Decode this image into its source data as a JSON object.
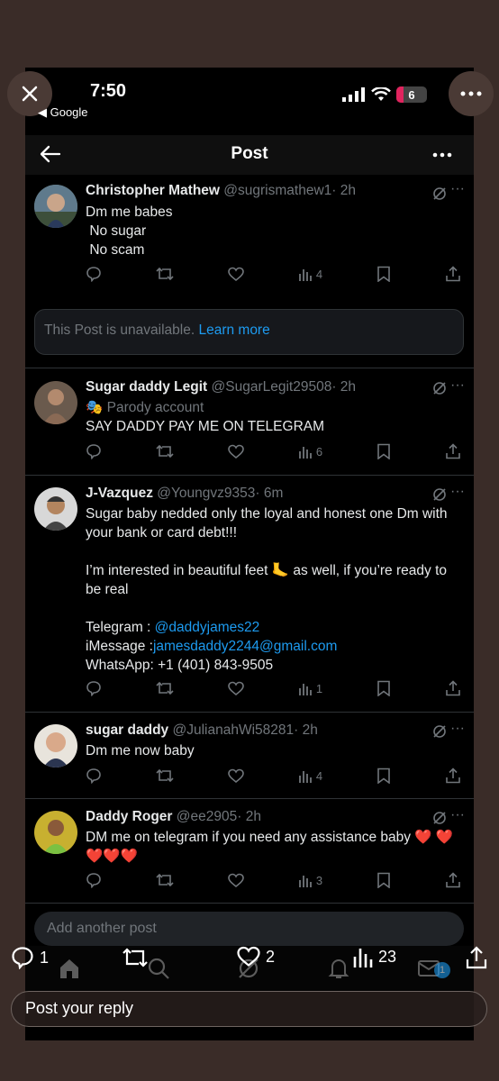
{
  "status": {
    "time": "7:50",
    "back_app": "◀ Google",
    "battery": "6"
  },
  "header": {
    "title": "Post"
  },
  "unavailable": {
    "text": "This Post is unavailable.",
    "link": "Learn more"
  },
  "posts": [
    {
      "name": "Christopher Mathew",
      "handle": "@sugrismathew1",
      "time": "· 2h",
      "lines": [
        "Dm me babes",
        " No sugar",
        " No scam"
      ],
      "views": "4"
    },
    {
      "name": "Sugar daddy Legit",
      "handle": "@SugarLegit29508",
      "time": "· 2h",
      "parody": "Parody account",
      "lines": [
        "SAY DADDY PAY ME ON TELEGRAM"
      ],
      "views": "6"
    },
    {
      "name": "J-Vazquez",
      "handle": "@Youngvz9353",
      "time": "· 6m",
      "line1": "Sugar baby nedded only the loyal and honest one Dm with your bank or card debt!!!",
      "line2a": "I’m interested in beautiful feet ",
      "line2b": "🦶",
      "line2c": " as well, if you’re ready to be real",
      "telegram_label": "Telegram : ",
      "telegram": "@daddyjames22",
      "imessage_label": "iMessage :",
      "imessage": "jamesdaddy2244@gmail.com",
      "whatsapp": "WhatsApp: +1 (401) 843-9505",
      "views": "1"
    },
    {
      "name": "sugar daddy",
      "handle": "@JulianahWi58281",
      "time": "· 2h",
      "lines": [
        "Dm me now baby"
      ],
      "views": "4"
    },
    {
      "name": "Daddy Roger",
      "handle": "@ee2905",
      "time": "· 2h",
      "text": "DM me on telegram if you need any assistance baby ❤️ ❤️❤️❤️❤️",
      "views": "3"
    }
  ],
  "add_post": "Add another post",
  "bottom": {
    "replies": "1",
    "likes": "2",
    "views": "23",
    "reply_placeholder": "Post your reply"
  },
  "tabs": {
    "notif_badge": "1"
  },
  "colors": {
    "accent": "#1d9bf0",
    "bg": "#000000",
    "muted": "#71767b",
    "outer": "#3a2c28"
  }
}
